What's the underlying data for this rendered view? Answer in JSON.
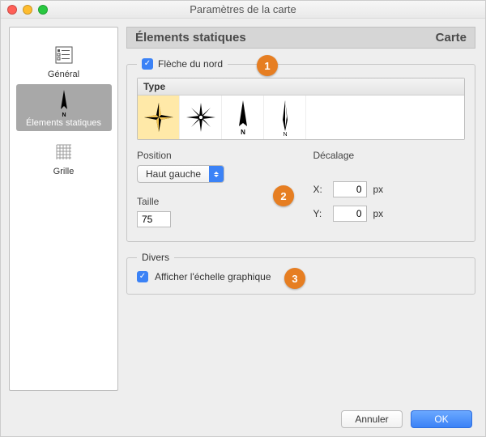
{
  "window": {
    "title": "Paramètres de la carte"
  },
  "sidebar": {
    "items": [
      {
        "label": "Général"
      },
      {
        "label": "Élements statiques"
      },
      {
        "label": "Grille"
      }
    ]
  },
  "header": {
    "left": "Élements statiques",
    "right": "Carte"
  },
  "north": {
    "legend": "Flèche du nord",
    "type_header": "Type",
    "position_label": "Position",
    "position_value": "Haut gauche",
    "taille_label": "Taille",
    "taille_value": "75",
    "decalage_label": "Décalage",
    "x_label": "X:",
    "x_value": "0",
    "y_label": "Y:",
    "y_value": "0",
    "unit": "px"
  },
  "misc": {
    "legend": "Divers",
    "scale_label": "Afficher l'échelle graphique"
  },
  "footer": {
    "cancel": "Annuler",
    "ok": "OK"
  },
  "badges": {
    "b1": "1",
    "b2": "2",
    "b3": "3"
  }
}
